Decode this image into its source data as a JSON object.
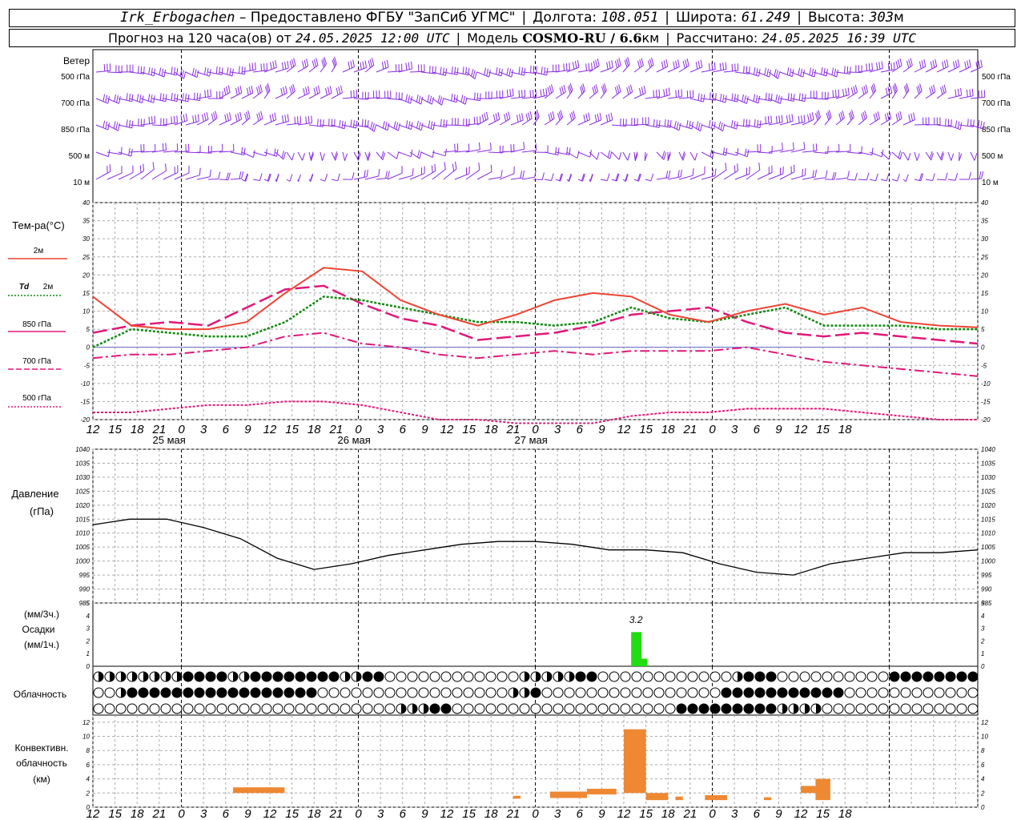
{
  "header": {
    "station": "Irk_Erbogachen",
    "provider": "– Предоставлено ФГБУ \"ЗапСиб УГМС\"",
    "lon_label": "Долгота:",
    "lon_value": "108.051",
    "lat_label": "Широта:",
    "lat_value": "61.249",
    "alt_label": "Высота:",
    "alt_value": "303",
    "alt_unit": "м",
    "forecast_label": "Прогноз на 120 часа(ов)  от",
    "forecast_start": "24.05.2025 12:00 UTC",
    "model_label": "Модель",
    "model_name": "COSMO-RU / 6.6",
    "model_unit": "км",
    "calc_label": "Рассчитано:",
    "calc_time": "24.05.2025 16:39 UTC"
  },
  "labels": {
    "wind": "Ветер",
    "wind_levels": [
      "500 гПа",
      "700 гПа",
      "850 гПа",
      "500 м",
      "10  м"
    ],
    "temp": "Тем-ра(°C)",
    "legend_2m": "2м",
    "legend_td_a": "Td",
    "legend_td_b": "2м",
    "legend_850": "850 гПа",
    "legend_700": "700 гПа",
    "legend_500": "500 гПа",
    "pressure_a": "Давление",
    "pressure_b": "(гПа)",
    "precip_a": "(мм/3ч.)",
    "precip_b": "Осадки",
    "precip_c": "(мм/1ч.)",
    "cloud": "Облачность",
    "conv_a": "Конвективн.",
    "conv_b": "облачность",
    "conv_c": "(км)",
    "precip_peak": "3.2"
  },
  "colors": {
    "wind": "#8a2be2",
    "t2m": "#ee4433",
    "td2m": "#118811",
    "t850": "#e0187a",
    "t700": "#e0187a",
    "t500": "#e0187a",
    "pressure": "#000000",
    "precip": "#22dd11",
    "conv": "#ee8833",
    "grid": "#999999"
  },
  "chart_data": [
    {
      "type": "line",
      "title": "Тем-ра(°C)",
      "x_hours": [
        0,
        6,
        12,
        18,
        24,
        30,
        36,
        42,
        48,
        54,
        60,
        66,
        72,
        78,
        84,
        90,
        96,
        102,
        108,
        114,
        120
      ],
      "x_tick_labels": [
        "12",
        "15",
        "18",
        "21",
        "0",
        "3",
        "6",
        "9",
        "12",
        "15",
        "18",
        "21",
        "0",
        "3",
        "6",
        "9",
        "12",
        "15",
        "18",
        "21",
        "0",
        "3",
        "6",
        "9",
        "12",
        "15",
        "18",
        "21",
        "0",
        "3",
        "6",
        "9",
        "12",
        "15",
        "18"
      ],
      "day_labels": [
        "25 мая",
        "26 мая",
        "27 мая"
      ],
      "ylim": [
        -20,
        40
      ],
      "yticks": [
        -20,
        -15,
        -10,
        -5,
        0,
        5,
        10,
        15,
        20,
        25,
        30,
        35,
        40
      ],
      "series": [
        {
          "name": "2м",
          "values": [
            14,
            6,
            5,
            5,
            7,
            15,
            22,
            21,
            13,
            9,
            6,
            9,
            13,
            15,
            14,
            9,
            7,
            10,
            12,
            9,
            11,
            7,
            6,
            5.5
          ]
        },
        {
          "name": "Td 2м",
          "values": [
            0,
            5,
            4,
            3,
            3,
            7,
            14,
            13,
            11,
            9,
            7,
            7,
            6,
            7,
            11,
            8,
            7,
            9,
            11,
            6,
            6,
            6,
            5,
            5
          ]
        },
        {
          "name": "850 гПа",
          "values": [
            4,
            6,
            7,
            6,
            11,
            16,
            17,
            12,
            8,
            6,
            2,
            3,
            4,
            6,
            9,
            10,
            11,
            7,
            4,
            3,
            4,
            3,
            2,
            1
          ]
        },
        {
          "name": "700 гПа",
          "values": [
            -3,
            -2,
            -2,
            -1,
            0,
            3,
            4,
            1,
            0,
            -2,
            -3,
            -2,
            -1,
            -2,
            -1,
            -1,
            -1,
            0,
            -2,
            -4,
            -5,
            -6,
            -7,
            -8
          ]
        },
        {
          "name": "500 гПа",
          "values": [
            -18,
            -18,
            -17,
            -16,
            -16,
            -15,
            -15,
            -16,
            -18,
            -20,
            -20,
            -21,
            -21,
            -21,
            -19,
            -18,
            -18,
            -17,
            -17,
            -17,
            -18,
            -19,
            -20,
            -20
          ]
        }
      ]
    },
    {
      "type": "line",
      "title": "Давление",
      "ylabel": "(гПа)",
      "ylim": [
        985,
        1040
      ],
      "yticks": [
        985,
        990,
        995,
        1000,
        1005,
        1010,
        1015,
        1020,
        1025,
        1030,
        1035,
        1040
      ],
      "series": [
        {
          "name": "Давление",
          "values": [
            1013,
            1015,
            1015,
            1012,
            1008,
            1001,
            997,
            999,
            1002,
            1004,
            1006,
            1007,
            1007,
            1006,
            1004,
            1004,
            1003,
            999,
            996,
            995,
            999,
            1001,
            1003,
            1003,
            1004
          ]
        }
      ]
    },
    {
      "type": "bar",
      "title": "Осадки",
      "ylim": [
        0,
        5
      ],
      "yticks": [
        0,
        1,
        2,
        3,
        4,
        5
      ],
      "bars": [
        {
          "x_hour": 73,
          "value": 2.7
        },
        {
          "x_hour": 74,
          "value": 0.6
        }
      ],
      "annotation": "3.2"
    },
    {
      "type": "bar",
      "title": "Конвективн. облачность",
      "ylabel": "(км)",
      "ylim": [
        0,
        13
      ],
      "yticks": [
        0,
        2,
        4,
        6,
        8,
        10,
        12
      ],
      "segments": [
        {
          "x0": 19,
          "x1": 26,
          "lo": 2.0,
          "hi": 2.8
        },
        {
          "x0": 57,
          "x1": 58,
          "lo": 1.2,
          "hi": 1.6
        },
        {
          "x0": 62,
          "x1": 67,
          "lo": 1.3,
          "hi": 2.2
        },
        {
          "x0": 67,
          "x1": 71,
          "lo": 1.8,
          "hi": 2.6
        },
        {
          "x0": 72,
          "x1": 75,
          "lo": 2.0,
          "hi": 11.0
        },
        {
          "x0": 75,
          "x1": 78,
          "lo": 1.0,
          "hi": 2.0
        },
        {
          "x0": 79,
          "x1": 80,
          "lo": 1.0,
          "hi": 1.5
        },
        {
          "x0": 83,
          "x1": 86,
          "lo": 1.0,
          "hi": 1.7
        },
        {
          "x0": 91,
          "x1": 92,
          "lo": 1.0,
          "hi": 1.4
        },
        {
          "x0": 96,
          "x1": 98,
          "lo": 2.0,
          "hi": 3.0
        },
        {
          "x0": 98,
          "x1": 100,
          "lo": 1.0,
          "hi": 4.0
        }
      ]
    }
  ],
  "clouds": {
    "rows": [
      "hhhhhhhhffffhhffffffffhhffoooooooooooohhhhhffoooooooooooohfffooooooooooffffffffffffffffffffffffffhffffffffff",
      "oohfffffffffffffffffooooooooooooooooohhfoooooooooooooooofffffffffffooooooooooooooffffffffhfhffhfhfhfoffffffff",
      "ooooooooooooooooooooooooooohhhffoooooooooooooooooooofffffffffhhhhooooooooooooooooffffffhhhhhhhhhhffffffffffff"
    ]
  }
}
